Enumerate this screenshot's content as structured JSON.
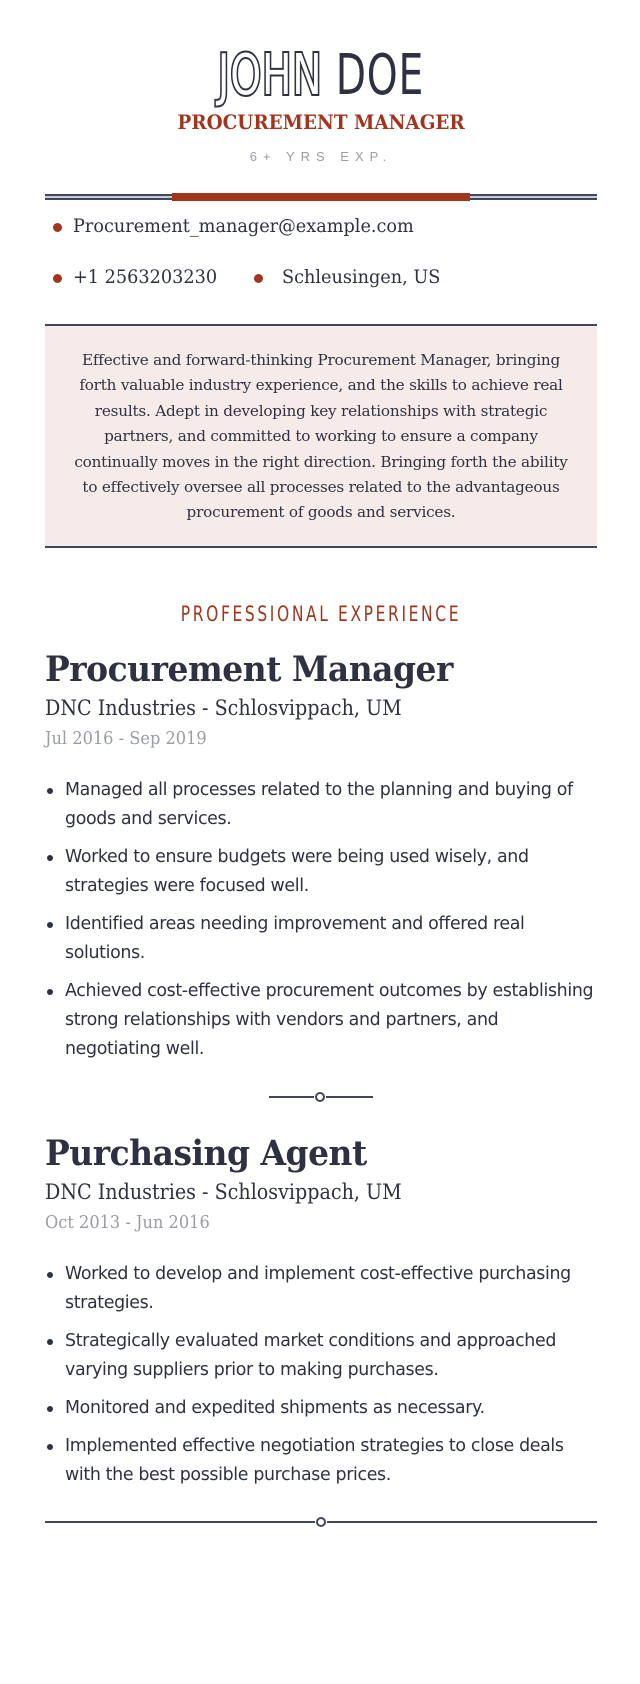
{
  "header": {
    "first_name": "JOHN",
    "last_name": "DOE",
    "role": "PROCUREMENT MANAGER",
    "experience": "6+ YRS EXP."
  },
  "contacts": {
    "email": "Procurement_manager@example.com",
    "phone": "+1 2563203230",
    "location": "Schleusingen, US"
  },
  "summary": "Effective and forward-thinking Procurement Manager, bringing forth valuable industry experience, and the skills to achieve real results. Adept in developing key relationships with strategic partners, and committed to working to ensure a company continually moves in the right direction. Bringing forth the ability to effectively oversee all processes related to the advantageous procurement of goods and services.",
  "experience": {
    "section_title": "PROFESSIONAL EXPERIENCE",
    "jobs": [
      {
        "title": "Procurement Manager",
        "company": "DNC Industries - Schlosvippach, UM",
        "dates": "Jul 2016 - Sep 2019",
        "bullets": [
          "Managed all processes related to the planning and buying of goods and services.",
          "Worked to ensure budgets were being used wisely, and strategies were focused well.",
          "Identified areas needing improvement and offered real solutions.",
          "Achieved cost-effective procurement outcomes by establishing strong relationships with vendors and partners, and negotiating well."
        ]
      },
      {
        "title": "Purchasing Agent",
        "company": "DNC Industries - Schlosvippach, UM",
        "dates": "Oct 2013 - Jun 2016",
        "bullets": [
          "Worked to develop and implement cost-effective purchasing strategies.",
          "Strategically evaluated market conditions and approached varying suppliers prior to making purchases.",
          "Monitored and expedited shipments as necessary.",
          "Implemented effective negotiation strategies to close deals with the best possible purchase prices."
        ]
      }
    ]
  },
  "colors": {
    "accent": "#a0361d",
    "text": "#2d3142",
    "muted": "#9a9ca6",
    "summary_bg": "#f6ebe9"
  }
}
